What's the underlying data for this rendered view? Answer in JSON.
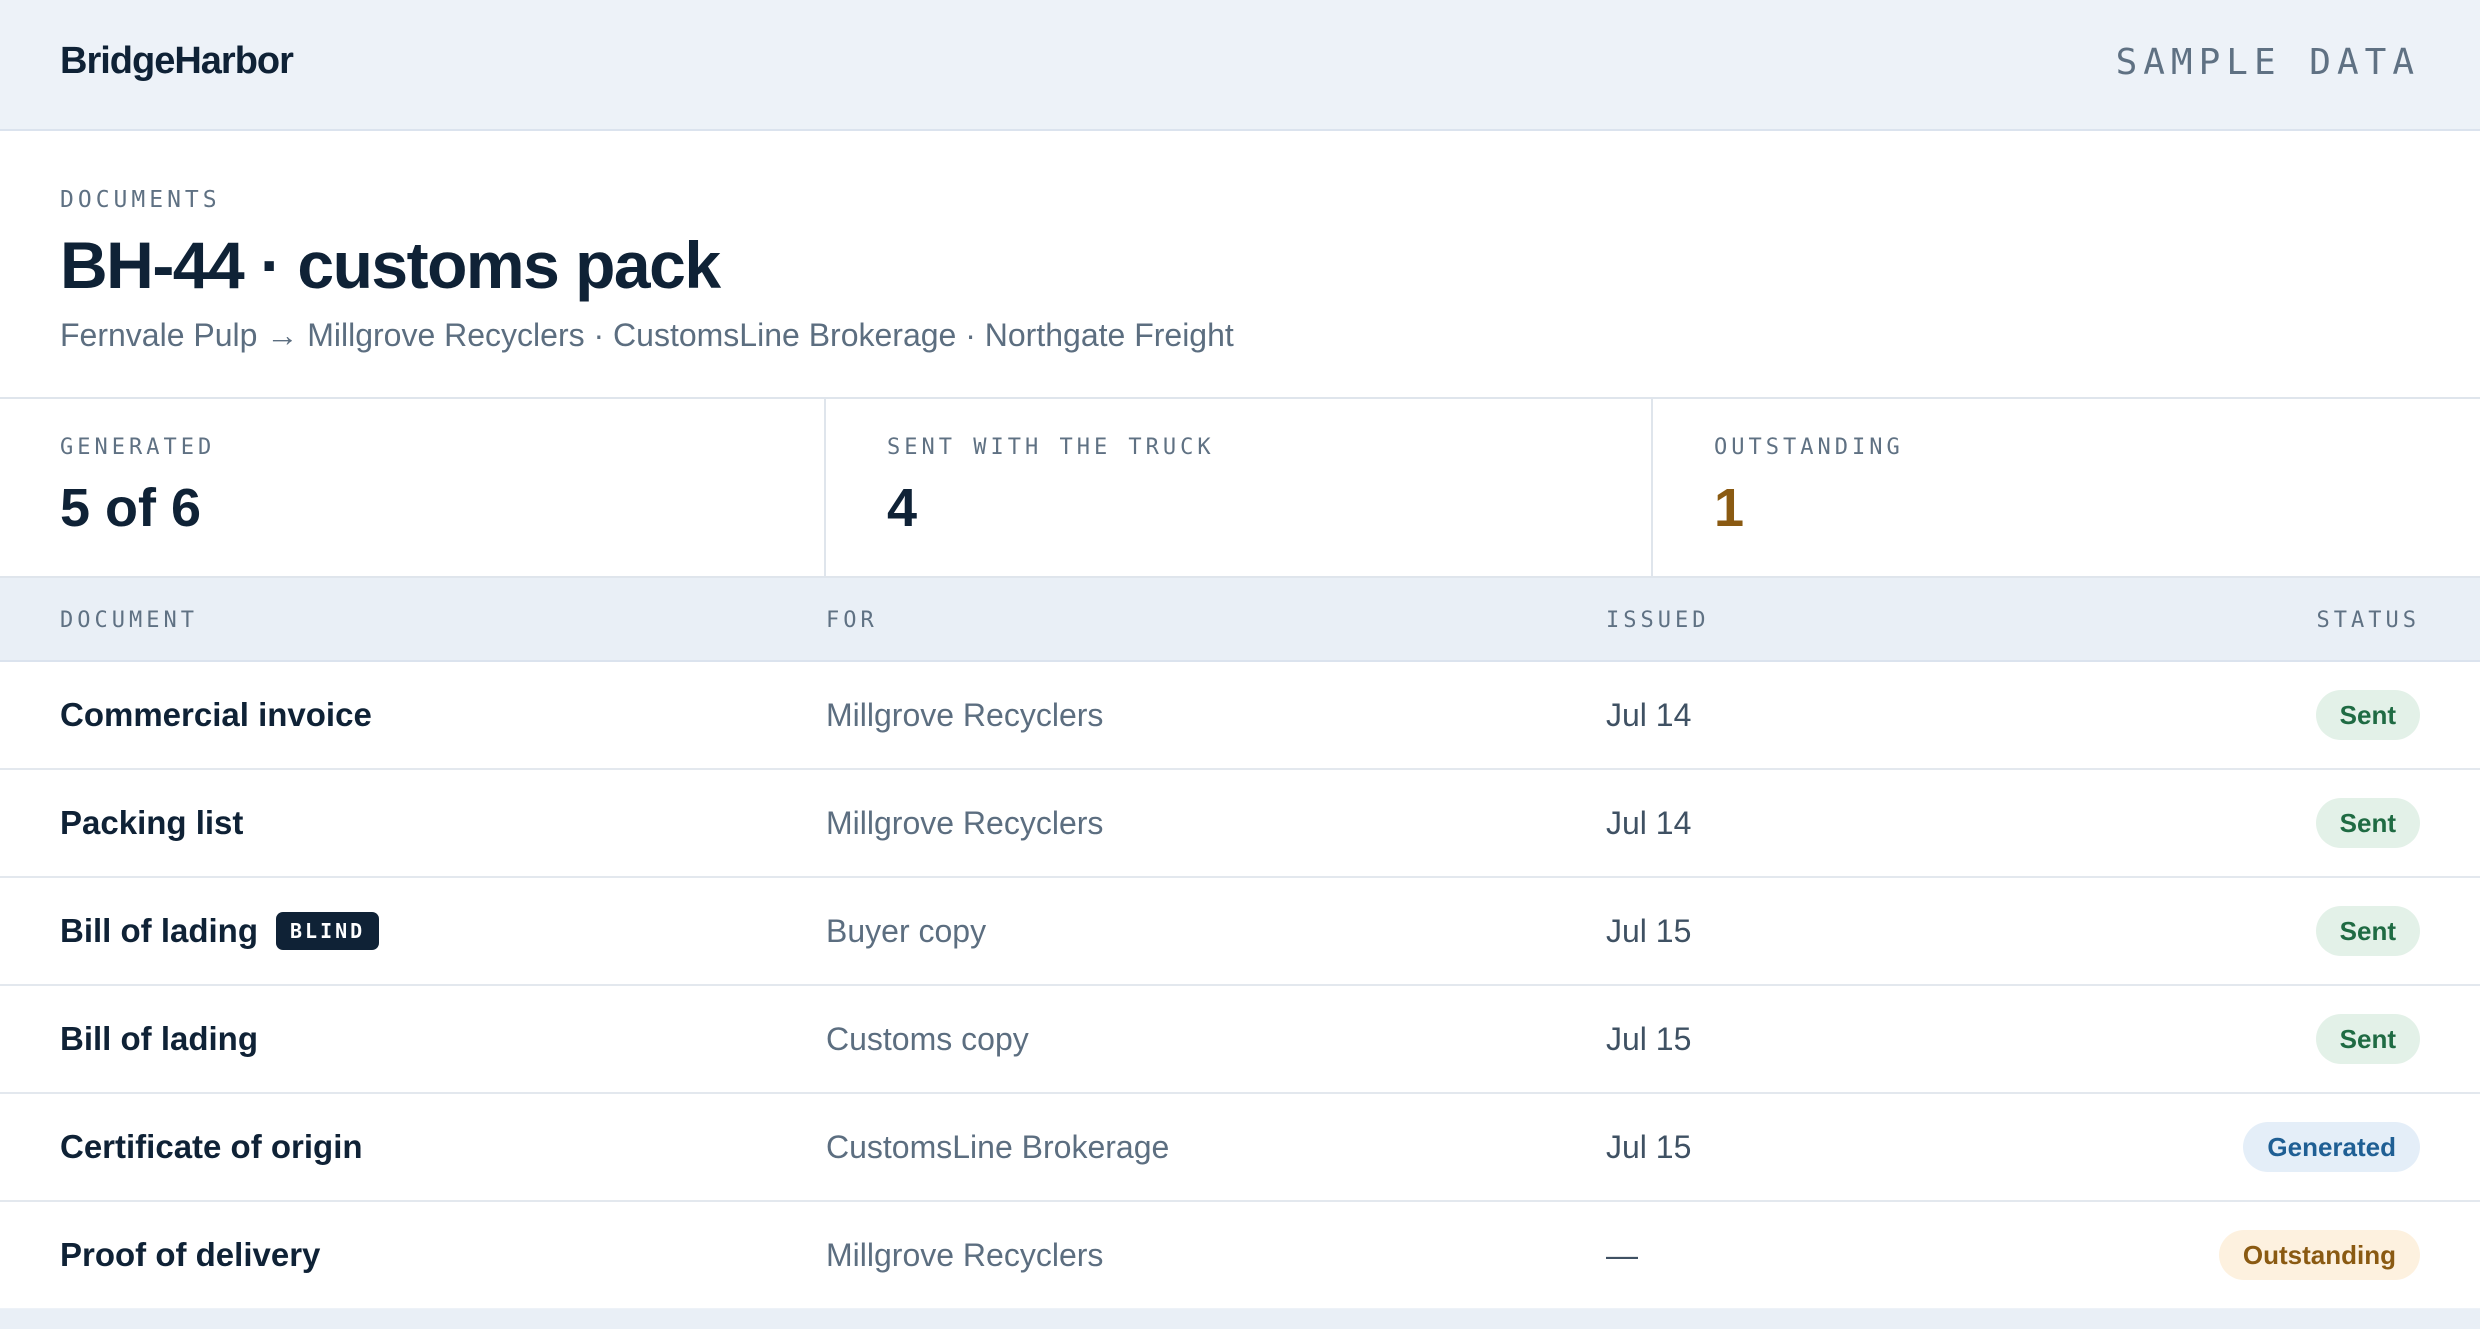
{
  "app": {
    "brand": "BridgeHarbor",
    "sample_label": "SAMPLE DATA"
  },
  "page": {
    "eyebrow": "DOCUMENTS",
    "title": "BH-44 · customs pack",
    "subtitle": "Fernvale Pulp → Millgrove Recyclers · CustomsLine Brokerage · Northgate Freight"
  },
  "stats": [
    {
      "label": "GENERATED",
      "value": "5 of 6"
    },
    {
      "label": "SENT WITH THE TRUCK",
      "value": "4"
    },
    {
      "label": "OUTSTANDING",
      "value": "1"
    }
  ],
  "table": {
    "columns": [
      "DOCUMENT",
      "FOR",
      "ISSUED",
      "STATUS"
    ],
    "rows": [
      {
        "document": "Commercial invoice",
        "tag": "",
        "for": "Millgrove Recyclers",
        "issued": "Jul 14",
        "status": "Sent"
      },
      {
        "document": "Packing list",
        "tag": "",
        "for": "Millgrove Recyclers",
        "issued": "Jul 14",
        "status": "Sent"
      },
      {
        "document": "Bill of lading",
        "tag": "BLIND",
        "for": "Buyer copy",
        "issued": "Jul 15",
        "status": "Sent"
      },
      {
        "document": "Bill of lading",
        "tag": "",
        "for": "Customs copy",
        "issued": "Jul 15",
        "status": "Sent"
      },
      {
        "document": "Certificate of origin",
        "tag": "",
        "for": "CustomsLine Brokerage",
        "issued": "Jul 15",
        "status": "Generated"
      },
      {
        "document": "Proof of delivery",
        "tag": "",
        "for": "Millgrove Recyclers",
        "issued": "—",
        "status": "Outstanding"
      }
    ]
  },
  "colors": {
    "ink": "#0f2236",
    "muted": "#5c6e80",
    "sent": "#1f6b43",
    "generated": "#1f5f94",
    "outstanding": "#8a5a12"
  }
}
